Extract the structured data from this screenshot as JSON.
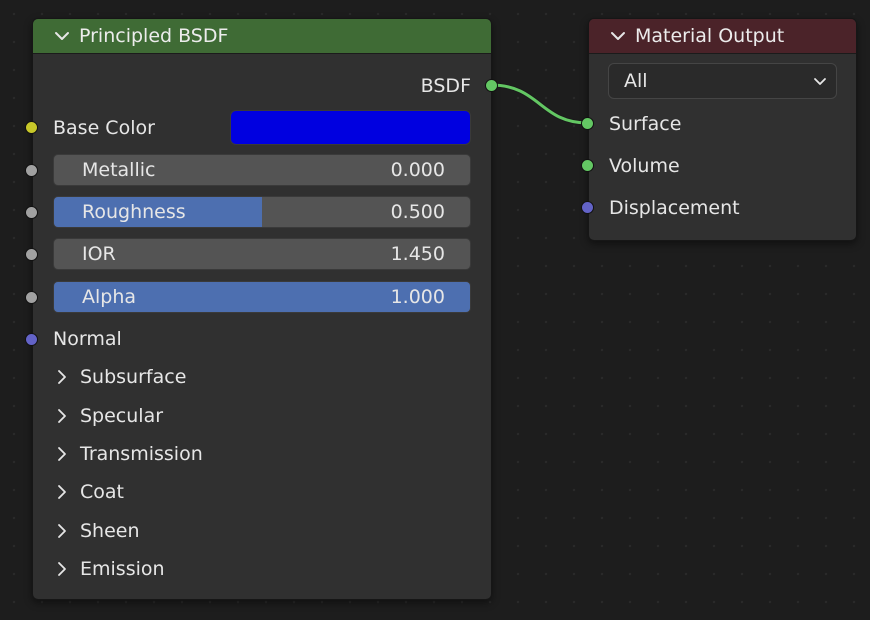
{
  "bsdf_node": {
    "title": "Principled BSDF",
    "output_label": "BSDF",
    "base_color_label": "Base Color",
    "base_color_value": "#0000e0",
    "metallic": {
      "label": "Metallic",
      "value": "0.000",
      "fraction": 0.0
    },
    "roughness": {
      "label": "Roughness",
      "value": "0.500",
      "fraction": 0.5
    },
    "ior": {
      "label": "IOR",
      "value": "1.450",
      "fraction": 0.0
    },
    "alpha": {
      "label": "Alpha",
      "value": "1.000",
      "fraction": 1.0
    },
    "normal_label": "Normal",
    "panels": [
      "Subsurface",
      "Specular",
      "Transmission",
      "Coat",
      "Sheen",
      "Emission"
    ]
  },
  "output_node": {
    "title": "Material Output",
    "target_value": "All",
    "surface_label": "Surface",
    "volume_label": "Volume",
    "displacement_label": "Displacement"
  },
  "colors": {
    "bsdf_header": "#3f6b35",
    "output_header": "#4b2329",
    "shader_socket": "#63c763",
    "color_socket": "#c7c729",
    "float_socket": "#a1a1a1",
    "vector_socket": "#6363c7",
    "link": "#63c763",
    "slider_fill": "#4d6fb0"
  }
}
